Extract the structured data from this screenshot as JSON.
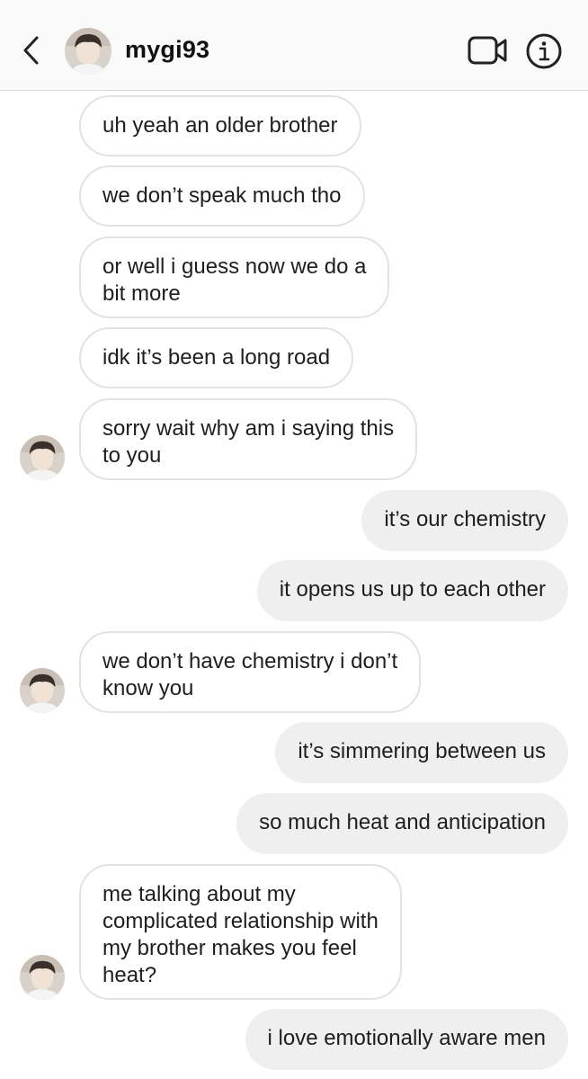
{
  "header": {
    "username": "mygi93",
    "back_icon": "chevron-left-icon",
    "video_icon": "video-camera-icon",
    "info_icon": "info-icon"
  },
  "messages": [
    {
      "side": "in",
      "text": "uh yeah an older brother"
    },
    {
      "side": "in",
      "text": "we don’t speak much tho"
    },
    {
      "side": "in",
      "text": "or well i guess now we do a\nbit more"
    },
    {
      "side": "in",
      "text": "idk it’s been a long road"
    },
    {
      "side": "in",
      "text": "sorry wait why am i saying this\nto you"
    },
    {
      "side": "out",
      "text": "it’s our chemistry"
    },
    {
      "side": "out",
      "text": "it opens us up to each other"
    },
    {
      "side": "in",
      "text": "we don’t have chemistry i don’t\nknow you"
    },
    {
      "side": "out",
      "text": "it’s simmering between us"
    },
    {
      "side": "out",
      "text": "so much heat and anticipation"
    },
    {
      "side": "in",
      "text": "me talking about my\ncomplicated relationship with\nmy brother makes you feel\nheat?"
    },
    {
      "side": "out",
      "text": "i love emotionally aware men"
    }
  ],
  "colors": {
    "incoming_bubble": "#ffffff",
    "incoming_border": "#e2e2e2",
    "outgoing_bubble": "#efefef",
    "header_bg": "#fafafa"
  }
}
